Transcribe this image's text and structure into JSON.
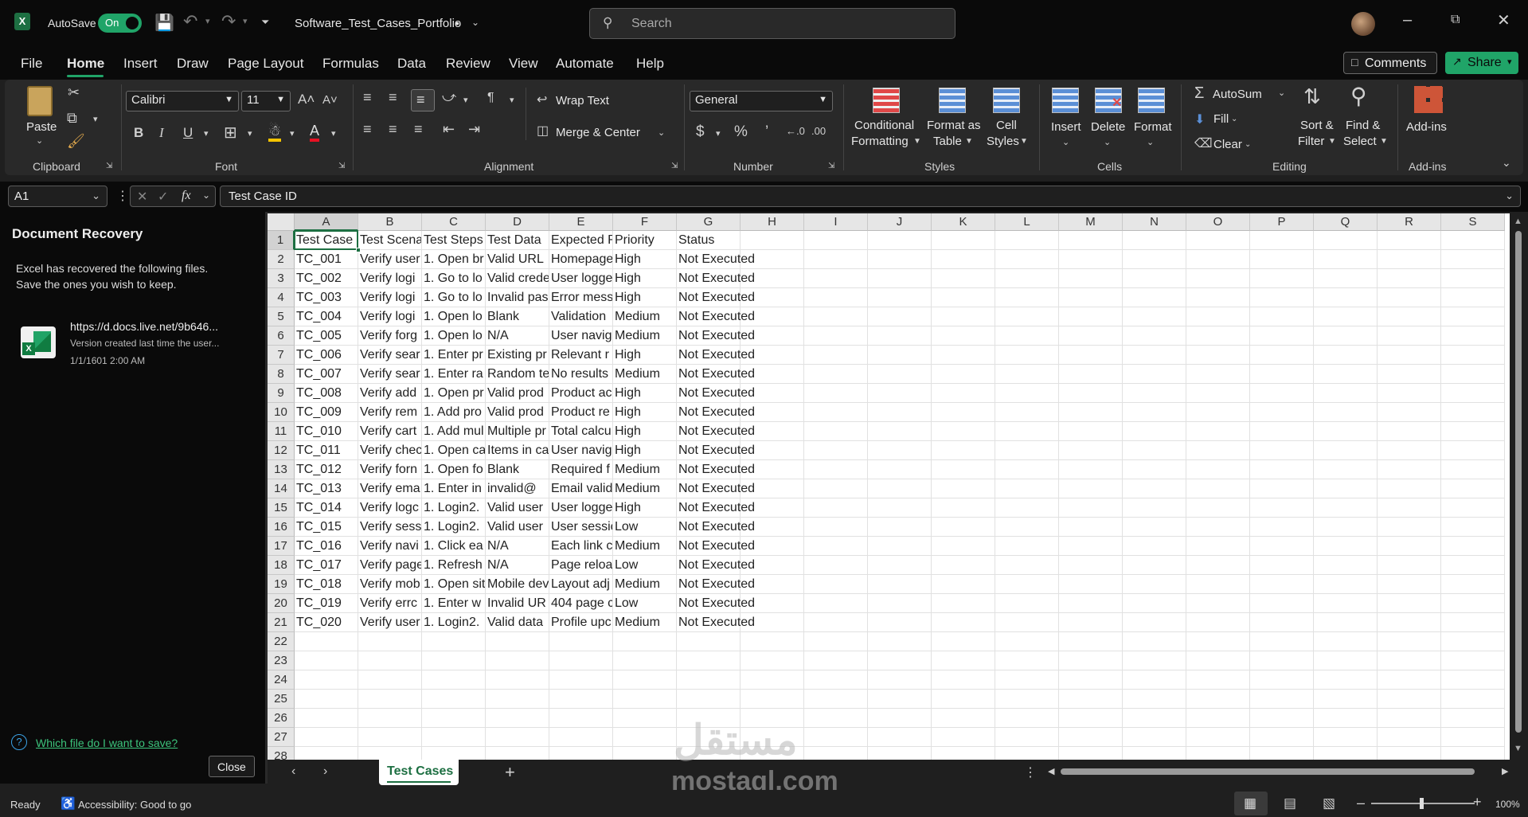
{
  "titlebar": {
    "autosave_label": "AutoSave",
    "autosave_state": "On",
    "file_name": "Software_Test_Cases_Portfolio",
    "saved_dot": "•",
    "search_placeholder": "Search"
  },
  "menu": {
    "items": [
      "File",
      "Home",
      "Insert",
      "Draw",
      "Page Layout",
      "Formulas",
      "Data",
      "Review",
      "View",
      "Automate",
      "Help"
    ],
    "active": "Home",
    "comments_label": "Comments",
    "share_label": "Share"
  },
  "ribbon": {
    "clipboard": {
      "paste": "Paste",
      "group": "Clipboard"
    },
    "font": {
      "name": "Calibri",
      "size": "11",
      "group": "Font"
    },
    "alignment": {
      "wrap": "Wrap Text",
      "merge": "Merge & Center",
      "group": "Alignment"
    },
    "number": {
      "format": "General",
      "group": "Number"
    },
    "styles": {
      "conditional_1": "Conditional",
      "conditional_2": "Formatting",
      "format_table_1": "Format as",
      "format_table_2": "Table",
      "cell_styles_1": "Cell",
      "cell_styles_2": "Styles",
      "group": "Styles"
    },
    "cells": {
      "insert": "Insert",
      "delete": "Delete",
      "format": "Format",
      "group": "Cells"
    },
    "editing": {
      "autosum": "AutoSum",
      "fill": "Fill",
      "clear": "Clear",
      "sort_1": "Sort &",
      "sort_2": "Filter",
      "find_1": "Find &",
      "find_2": "Select",
      "group": "Editing"
    },
    "addins": {
      "label": "Add-ins",
      "group": "Add-ins"
    }
  },
  "formula_bar": {
    "name_box": "A1",
    "fx": "fx",
    "content": "Test Case ID"
  },
  "recovery": {
    "title": "Document Recovery",
    "message_1": "Excel has recovered the following files.",
    "message_2": "Save the ones you wish to keep.",
    "file_url": "https://d.docs.live.net/9b646...",
    "file_desc": "Version created last time the user...",
    "file_date": "1/1/1601 2:00 AM",
    "help_link": "Which file do I want to save?",
    "close_label": "Close"
  },
  "sheet": {
    "columns": [
      "A",
      "B",
      "C",
      "D",
      "E",
      "F",
      "G",
      "H",
      "I",
      "J",
      "K",
      "L",
      "M",
      "N",
      "O",
      "P",
      "Q",
      "R",
      "S"
    ],
    "row_numbers": [
      "1",
      "2",
      "3",
      "4",
      "5",
      "6",
      "7",
      "8",
      "9",
      "10",
      "11",
      "12",
      "13",
      "14",
      "15",
      "16",
      "17",
      "18",
      "19",
      "20",
      "21",
      "22",
      "23",
      "24",
      "25",
      "26",
      "27",
      "28"
    ],
    "rows": [
      [
        "Test Case",
        "Test Scena",
        "Test Steps",
        "Test Data",
        "Expected R",
        "Priority",
        "Status"
      ],
      [
        "TC_001",
        "Verify user",
        "1. Open br",
        "Valid URL",
        "Homepage",
        "High",
        "Not Executed"
      ],
      [
        "TC_002",
        "Verify logi",
        "1. Go to lo",
        "Valid crede",
        "User logge",
        "High",
        "Not Executed"
      ],
      [
        "TC_003",
        "Verify logi",
        "1. Go to lo",
        "Invalid pas",
        "Error mess",
        "High",
        "Not Executed"
      ],
      [
        "TC_004",
        "Verify logi",
        "1. Open lo",
        "Blank",
        "Validation",
        "Medium",
        "Not Executed"
      ],
      [
        "TC_005",
        "Verify forg",
        "1. Open lo",
        "N/A",
        "User navig",
        "Medium",
        "Not Executed"
      ],
      [
        "TC_006",
        "Verify sear",
        "1. Enter pr",
        "Existing pr",
        "Relevant r",
        "High",
        "Not Executed"
      ],
      [
        "TC_007",
        "Verify sear",
        "1. Enter ra",
        "Random te",
        "No results",
        "Medium",
        "Not Executed"
      ],
      [
        "TC_008",
        "Verify add",
        "1. Open pr",
        "Valid prod",
        "Product ac",
        "High",
        "Not Executed"
      ],
      [
        "TC_009",
        "Verify rem",
        "1. Add pro",
        "Valid prod",
        "Product re",
        "High",
        "Not Executed"
      ],
      [
        "TC_010",
        "Verify cart",
        "1. Add mul",
        "Multiple pr",
        "Total calcu",
        "High",
        "Not Executed"
      ],
      [
        "TC_011",
        "Verify chec",
        "1. Open ca",
        "Items in ca",
        "User navig",
        "High",
        "Not Executed"
      ],
      [
        "TC_012",
        "Verify forn",
        "1. Open fo",
        "Blank",
        "Required f",
        "Medium",
        "Not Executed"
      ],
      [
        "TC_013",
        "Verify ema",
        "1. Enter in",
        "invalid@",
        "Email valid",
        "Medium",
        "Not Executed"
      ],
      [
        "TC_014",
        "Verify logc",
        "1. Login2.",
        "Valid user",
        "User logge",
        "High",
        "Not Executed"
      ],
      [
        "TC_015",
        "Verify sess",
        "1. Login2.",
        "Valid user",
        "User sessic",
        "Low",
        "Not Executed"
      ],
      [
        "TC_016",
        "Verify navi",
        "1. Click ea",
        "N/A",
        "Each link c",
        "Medium",
        "Not Executed"
      ],
      [
        "TC_017",
        "Verify page",
        "1. Refresh",
        "N/A",
        "Page reloa",
        "Low",
        "Not Executed"
      ],
      [
        "TC_018",
        "Verify mob",
        "1. Open sit",
        "Mobile dev",
        "Layout adj",
        "Medium",
        "Not Executed"
      ],
      [
        "TC_019",
        "Verify errc",
        "1. Enter w",
        "Invalid UR",
        "404 page c",
        "Low",
        "Not Executed"
      ],
      [
        "TC_020",
        "Verify user",
        "1. Login2.",
        "Valid data",
        "Profile upc",
        "Medium",
        "Not Executed"
      ]
    ]
  },
  "tabs": {
    "active_sheet": "Test Cases",
    "add": "+"
  },
  "watermark": {
    "brand_ar": "مستقل",
    "brand_en": "mostaql.com"
  },
  "status": {
    "ready": "Ready",
    "accessibility": "Accessibility: Good to go",
    "zoom": "100%"
  }
}
